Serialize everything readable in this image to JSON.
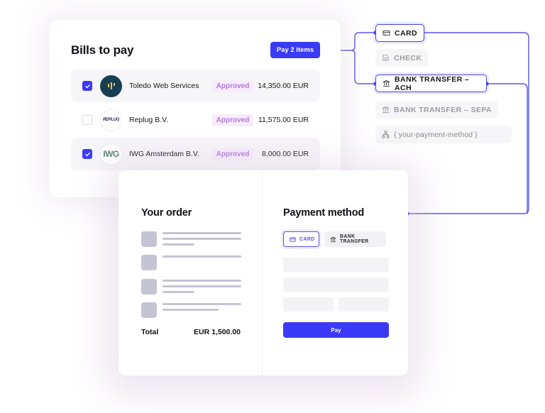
{
  "bills": {
    "title": "Bills to pay",
    "pay_button": "Pay 2 items",
    "rows": [
      {
        "vendor": "Toledo Web Services",
        "status": "Approved",
        "amount": "14,350.00 EUR",
        "checked": true,
        "logo": "toledo-logo"
      },
      {
        "vendor": "Replug B.V.",
        "status": "Approved",
        "amount": "11,575.00 EUR",
        "checked": false,
        "logo": "replug-logo",
        "logo_text": "REPLUG"
      },
      {
        "vendor": "IWG Amsterdam B.V.",
        "status": "Approved",
        "amount": "8,000.00 EUR",
        "checked": true,
        "logo": "iwg-logo",
        "logo_text": "IWG"
      }
    ]
  },
  "methods": [
    {
      "label": "CARD",
      "icon": "card-icon",
      "state": "active"
    },
    {
      "label": "CHECK",
      "icon": "check-document-icon",
      "state": "inactive"
    },
    {
      "label": "BANK TRANSFER – ACH",
      "icon": "bank-icon",
      "state": "active"
    },
    {
      "label": "BANK TRANSFER – SEPA",
      "icon": "bank-icon",
      "state": "inactive"
    },
    {
      "label": "{ your-payment-method }",
      "icon": "sitemap-icon",
      "state": "custom"
    }
  ],
  "checkout": {
    "order_title": "Your order",
    "total_label": "Total",
    "total_value": "EUR 1,500.00",
    "payment_title": "Payment method",
    "tabs": [
      {
        "label": "CARD",
        "icon": "card-icon",
        "selected": true
      },
      {
        "label": "BANK TRANSFER",
        "icon": "bank-icon",
        "selected": false
      }
    ],
    "pay_button": "Pay"
  },
  "colors": {
    "accent": "#3a3af7",
    "connector": "#5a52e6",
    "badge_bg": "#f6ecfb",
    "badge_text": "#b57ad6",
    "placeholder": "#c5c4d4"
  }
}
